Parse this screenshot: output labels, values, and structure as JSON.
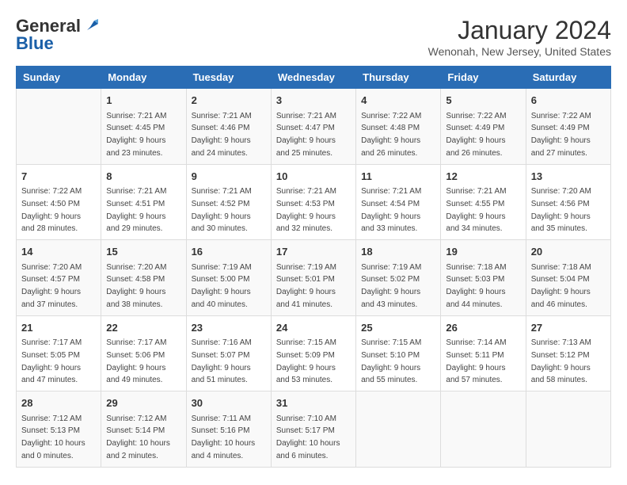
{
  "logo": {
    "general": "General",
    "blue": "Blue"
  },
  "title": "January 2024",
  "subtitle": "Wenonah, New Jersey, United States",
  "headers": [
    "Sunday",
    "Monday",
    "Tuesday",
    "Wednesday",
    "Thursday",
    "Friday",
    "Saturday"
  ],
  "weeks": [
    [
      {
        "day": "",
        "info": ""
      },
      {
        "day": "1",
        "info": "Sunrise: 7:21 AM\nSunset: 4:45 PM\nDaylight: 9 hours\nand 23 minutes."
      },
      {
        "day": "2",
        "info": "Sunrise: 7:21 AM\nSunset: 4:46 PM\nDaylight: 9 hours\nand 24 minutes."
      },
      {
        "day": "3",
        "info": "Sunrise: 7:21 AM\nSunset: 4:47 PM\nDaylight: 9 hours\nand 25 minutes."
      },
      {
        "day": "4",
        "info": "Sunrise: 7:22 AM\nSunset: 4:48 PM\nDaylight: 9 hours\nand 26 minutes."
      },
      {
        "day": "5",
        "info": "Sunrise: 7:22 AM\nSunset: 4:49 PM\nDaylight: 9 hours\nand 26 minutes."
      },
      {
        "day": "6",
        "info": "Sunrise: 7:22 AM\nSunset: 4:49 PM\nDaylight: 9 hours\nand 27 minutes."
      }
    ],
    [
      {
        "day": "7",
        "info": "Sunrise: 7:22 AM\nSunset: 4:50 PM\nDaylight: 9 hours\nand 28 minutes."
      },
      {
        "day": "8",
        "info": "Sunrise: 7:21 AM\nSunset: 4:51 PM\nDaylight: 9 hours\nand 29 minutes."
      },
      {
        "day": "9",
        "info": "Sunrise: 7:21 AM\nSunset: 4:52 PM\nDaylight: 9 hours\nand 30 minutes."
      },
      {
        "day": "10",
        "info": "Sunrise: 7:21 AM\nSunset: 4:53 PM\nDaylight: 9 hours\nand 32 minutes."
      },
      {
        "day": "11",
        "info": "Sunrise: 7:21 AM\nSunset: 4:54 PM\nDaylight: 9 hours\nand 33 minutes."
      },
      {
        "day": "12",
        "info": "Sunrise: 7:21 AM\nSunset: 4:55 PM\nDaylight: 9 hours\nand 34 minutes."
      },
      {
        "day": "13",
        "info": "Sunrise: 7:20 AM\nSunset: 4:56 PM\nDaylight: 9 hours\nand 35 minutes."
      }
    ],
    [
      {
        "day": "14",
        "info": "Sunrise: 7:20 AM\nSunset: 4:57 PM\nDaylight: 9 hours\nand 37 minutes."
      },
      {
        "day": "15",
        "info": "Sunrise: 7:20 AM\nSunset: 4:58 PM\nDaylight: 9 hours\nand 38 minutes."
      },
      {
        "day": "16",
        "info": "Sunrise: 7:19 AM\nSunset: 5:00 PM\nDaylight: 9 hours\nand 40 minutes."
      },
      {
        "day": "17",
        "info": "Sunrise: 7:19 AM\nSunset: 5:01 PM\nDaylight: 9 hours\nand 41 minutes."
      },
      {
        "day": "18",
        "info": "Sunrise: 7:19 AM\nSunset: 5:02 PM\nDaylight: 9 hours\nand 43 minutes."
      },
      {
        "day": "19",
        "info": "Sunrise: 7:18 AM\nSunset: 5:03 PM\nDaylight: 9 hours\nand 44 minutes."
      },
      {
        "day": "20",
        "info": "Sunrise: 7:18 AM\nSunset: 5:04 PM\nDaylight: 9 hours\nand 46 minutes."
      }
    ],
    [
      {
        "day": "21",
        "info": "Sunrise: 7:17 AM\nSunset: 5:05 PM\nDaylight: 9 hours\nand 47 minutes."
      },
      {
        "day": "22",
        "info": "Sunrise: 7:17 AM\nSunset: 5:06 PM\nDaylight: 9 hours\nand 49 minutes."
      },
      {
        "day": "23",
        "info": "Sunrise: 7:16 AM\nSunset: 5:07 PM\nDaylight: 9 hours\nand 51 minutes."
      },
      {
        "day": "24",
        "info": "Sunrise: 7:15 AM\nSunset: 5:09 PM\nDaylight: 9 hours\nand 53 minutes."
      },
      {
        "day": "25",
        "info": "Sunrise: 7:15 AM\nSunset: 5:10 PM\nDaylight: 9 hours\nand 55 minutes."
      },
      {
        "day": "26",
        "info": "Sunrise: 7:14 AM\nSunset: 5:11 PM\nDaylight: 9 hours\nand 57 minutes."
      },
      {
        "day": "27",
        "info": "Sunrise: 7:13 AM\nSunset: 5:12 PM\nDaylight: 9 hours\nand 58 minutes."
      }
    ],
    [
      {
        "day": "28",
        "info": "Sunrise: 7:12 AM\nSunset: 5:13 PM\nDaylight: 10 hours\nand 0 minutes."
      },
      {
        "day": "29",
        "info": "Sunrise: 7:12 AM\nSunset: 5:14 PM\nDaylight: 10 hours\nand 2 minutes."
      },
      {
        "day": "30",
        "info": "Sunrise: 7:11 AM\nSunset: 5:16 PM\nDaylight: 10 hours\nand 4 minutes."
      },
      {
        "day": "31",
        "info": "Sunrise: 7:10 AM\nSunset: 5:17 PM\nDaylight: 10 hours\nand 6 minutes."
      },
      {
        "day": "",
        "info": ""
      },
      {
        "day": "",
        "info": ""
      },
      {
        "day": "",
        "info": ""
      }
    ]
  ]
}
